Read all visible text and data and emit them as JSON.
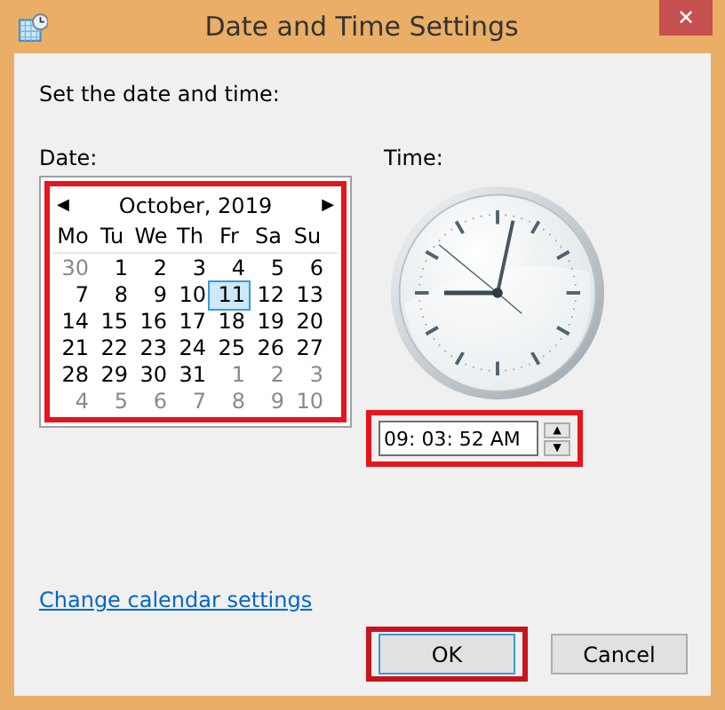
{
  "window": {
    "title": "Date and Time Settings"
  },
  "instruction": "Set the date and time:",
  "date_label": "Date:",
  "time_label": "Time:",
  "calendar": {
    "month": "October, 2019",
    "prev": "◀",
    "next": "▶",
    "highlighted": true,
    "weekdays": [
      "Mo",
      "Tu",
      "We",
      "Th",
      "Fr",
      "Sa",
      "Su"
    ],
    "weeks": [
      [
        {
          "day": "30",
          "other_month": true,
          "selected": false
        },
        {
          "day": "1",
          "other_month": false,
          "selected": false
        },
        {
          "day": "2",
          "other_month": false,
          "selected": false
        },
        {
          "day": "3",
          "other_month": false,
          "selected": false
        },
        {
          "day": "4",
          "other_month": false,
          "selected": false
        },
        {
          "day": "5",
          "other_month": false,
          "selected": false
        },
        {
          "day": "6",
          "other_month": false,
          "selected": false
        }
      ],
      [
        {
          "day": "7",
          "other_month": false,
          "selected": false
        },
        {
          "day": "8",
          "other_month": false,
          "selected": false
        },
        {
          "day": "9",
          "other_month": false,
          "selected": false
        },
        {
          "day": "10",
          "other_month": false,
          "selected": false
        },
        {
          "day": "11",
          "other_month": false,
          "selected": true
        },
        {
          "day": "12",
          "other_month": false,
          "selected": false
        },
        {
          "day": "13",
          "other_month": false,
          "selected": false
        }
      ],
      [
        {
          "day": "14",
          "other_month": false,
          "selected": false
        },
        {
          "day": "15",
          "other_month": false,
          "selected": false
        },
        {
          "day": "16",
          "other_month": false,
          "selected": false
        },
        {
          "day": "17",
          "other_month": false,
          "selected": false
        },
        {
          "day": "18",
          "other_month": false,
          "selected": false
        },
        {
          "day": "19",
          "other_month": false,
          "selected": false
        },
        {
          "day": "20",
          "other_month": false,
          "selected": false
        }
      ],
      [
        {
          "day": "21",
          "other_month": false,
          "selected": false
        },
        {
          "day": "22",
          "other_month": false,
          "selected": false
        },
        {
          "day": "23",
          "other_month": false,
          "selected": false
        },
        {
          "day": "24",
          "other_month": false,
          "selected": false
        },
        {
          "day": "25",
          "other_month": false,
          "selected": false
        },
        {
          "day": "26",
          "other_month": false,
          "selected": false
        },
        {
          "day": "27",
          "other_month": false,
          "selected": false
        }
      ],
      [
        {
          "day": "28",
          "other_month": false,
          "selected": false
        },
        {
          "day": "29",
          "other_month": false,
          "selected": false
        },
        {
          "day": "30",
          "other_month": false,
          "selected": false
        },
        {
          "day": "31",
          "other_month": false,
          "selected": false
        },
        {
          "day": "1",
          "other_month": true,
          "selected": false
        },
        {
          "day": "2",
          "other_month": true,
          "selected": false
        },
        {
          "day": "3",
          "other_month": true,
          "selected": false
        }
      ],
      [
        {
          "day": "4",
          "other_month": true,
          "selected": false
        },
        {
          "day": "5",
          "other_month": true,
          "selected": false
        },
        {
          "day": "6",
          "other_month": true,
          "selected": false
        },
        {
          "day": "7",
          "other_month": true,
          "selected": false
        },
        {
          "day": "8",
          "other_month": true,
          "selected": false
        },
        {
          "day": "9",
          "other_month": true,
          "selected": false
        },
        {
          "day": "10",
          "other_month": true,
          "selected": false
        }
      ]
    ]
  },
  "time_field": {
    "value": "09: 03: 52 AM",
    "up": "▲",
    "down": "▼",
    "highlighted": true
  },
  "link": "Change calendar settings",
  "buttons": [
    {
      "label": "OK",
      "default": true,
      "highlighted": true
    },
    {
      "label": "Cancel",
      "default": false,
      "highlighted": false
    }
  ],
  "close": "✕"
}
